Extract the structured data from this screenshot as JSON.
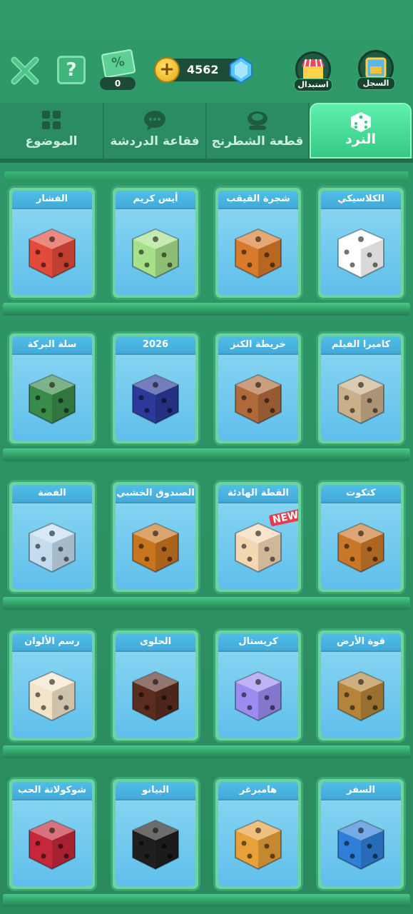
{
  "header": {
    "close_icon": "close-icon",
    "help_label": "?",
    "coupon": {
      "symbol": "%",
      "count": "0"
    },
    "coins": {
      "value": "4562"
    },
    "shop_label": "استبدال",
    "record_label": "السجل"
  },
  "tabs": [
    {
      "label": "النرد",
      "icon": "dice-icon",
      "active": true
    },
    {
      "label": "قطعة الشطرنج",
      "icon": "chess-piece-icon",
      "active": false
    },
    {
      "label": "فقاعة الدردشة",
      "icon": "chat-bubble-icon",
      "active": false
    },
    {
      "label": "الموضوع",
      "icon": "theme-grid-icon",
      "active": false
    }
  ],
  "dice_rows": [
    [
      {
        "name": "الكلاسيكي",
        "color": "#ffffff"
      },
      {
        "name": "شجرة القيقب",
        "color": "#d97a2a"
      },
      {
        "name": "أيس كريم",
        "color": "#a7e08a"
      },
      {
        "name": "الفشار",
        "color": "#e24b3c"
      }
    ],
    [
      {
        "name": "كاميرا الفيلم",
        "color": "#c9b08b"
      },
      {
        "name": "خريطة الكنز",
        "color": "#b06a3a"
      },
      {
        "name": "2026",
        "color": "#2b3a9a"
      },
      {
        "name": "سلة البركة",
        "color": "#3a8a4a"
      }
    ],
    [
      {
        "name": "كتكوت",
        "color": "#c9782a"
      },
      {
        "name": "القطة الهادئة",
        "color": "#f4d8b4",
        "badge": "NEW"
      },
      {
        "name": "الصندوق الخشبي",
        "color": "#c9741f"
      },
      {
        "name": "الفضة",
        "color": "#c4dcee"
      }
    ],
    [
      {
        "name": "قوة الأرض",
        "color": "#b5843a"
      },
      {
        "name": "كريستال",
        "color": "#9b8df0"
      },
      {
        "name": "الحلوى",
        "color": "#5a2d1f"
      },
      {
        "name": "رسم الألوان",
        "color": "#f2e4c9"
      }
    ],
    [
      {
        "name": "السفر",
        "color": "#2f7ed8"
      },
      {
        "name": "هامبرغر",
        "color": "#e7a03a"
      },
      {
        "name": "البيانو",
        "color": "#1f1f1f"
      },
      {
        "name": "شوكولاتة الحب",
        "color": "#c4283a"
      }
    ]
  ]
}
